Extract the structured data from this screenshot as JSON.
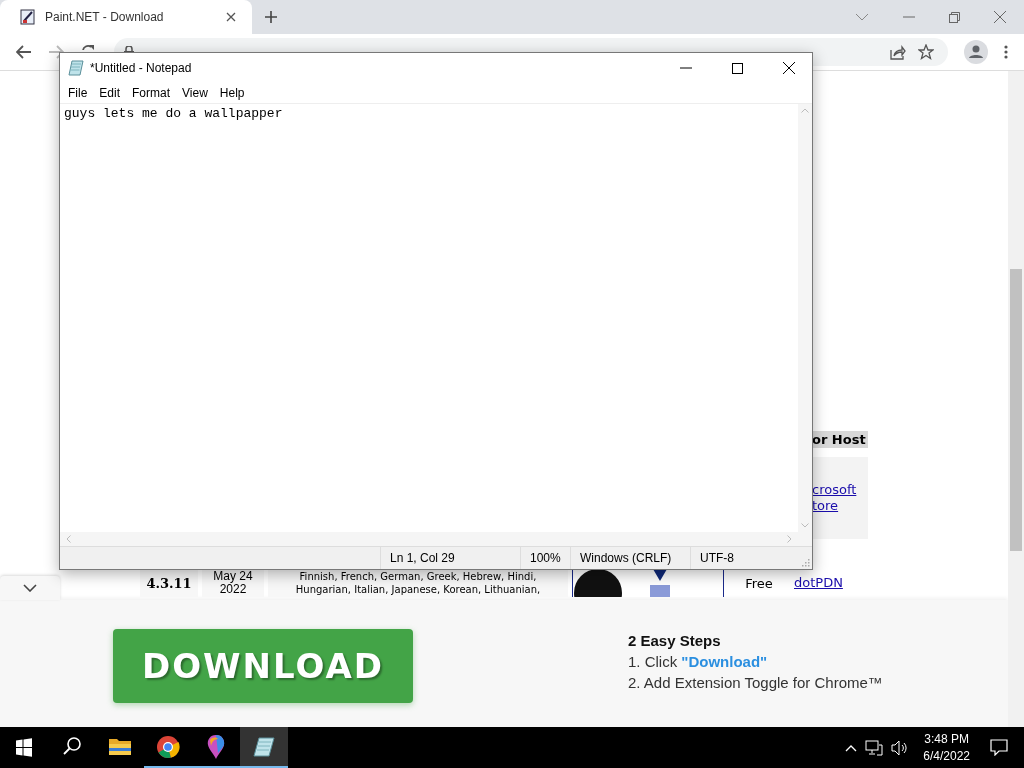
{
  "browser": {
    "tab": {
      "title": "Paint.NET - Download"
    }
  },
  "page": {
    "table_header": "or Host",
    "host_link_lines": [
      "crosoft",
      "tore"
    ],
    "row": {
      "version": "4.3.11",
      "date_lines": [
        "May 24",
        "2022"
      ],
      "language_lines": [
        "Finnish, French, German, Greek, Hebrew, Hindi,",
        "Hungarian, Italian, Japanese, Korean, Lithuanian,"
      ],
      "price": "Free",
      "host": "dotPDN"
    }
  },
  "ad": {
    "button": "DOWNLOAD",
    "heading": "2 Easy Steps",
    "steps": [
      "1. Click **\"Download\"**",
      "2. Add Extension Toggle for Chrome™"
    ]
  },
  "notepad": {
    "title": "*Untitled - Notepad",
    "menu": [
      "File",
      "Edit",
      "Format",
      "View",
      "Help"
    ],
    "text": "guys lets me do a wallpapper",
    "status": [
      "Ln 1, Col 29",
      "100%",
      "Windows (CRLF)",
      "UTF-8"
    ]
  },
  "taskbar": {
    "apps": [
      {
        "kind": "explorer",
        "running": false,
        "selected": false
      },
      {
        "kind": "chrome",
        "running": true,
        "selected": false
      },
      {
        "kind": "paint3d",
        "running": true,
        "selected": false
      },
      {
        "kind": "notepad",
        "running": true,
        "selected": true
      }
    ],
    "time": "3:48 PM",
    "date": "6/4/2022"
  }
}
